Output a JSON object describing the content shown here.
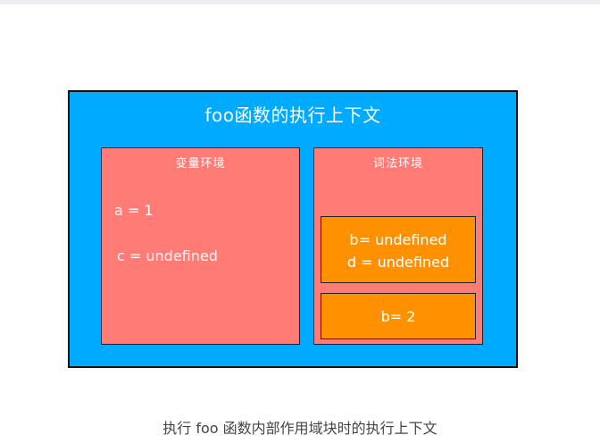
{
  "diagram": {
    "outer_title": "foo函数的执行上下文",
    "variable_environment": {
      "title": "变量环境",
      "entries": [
        "a = 1",
        "c = undefined"
      ]
    },
    "lexical_environment": {
      "title": "词法环境",
      "blocks": [
        {
          "lines": [
            "b= undefined",
            "d = undefined"
          ]
        },
        {
          "lines": [
            "b= 2"
          ]
        }
      ]
    },
    "colors": {
      "context_background": "#00aaff",
      "environment_background": "#ff7b76",
      "block_background": "#ff9000",
      "border": "#111111",
      "text": "#ffffff"
    }
  },
  "caption": "执行 foo 函数内部作用域块时的执行上下文"
}
